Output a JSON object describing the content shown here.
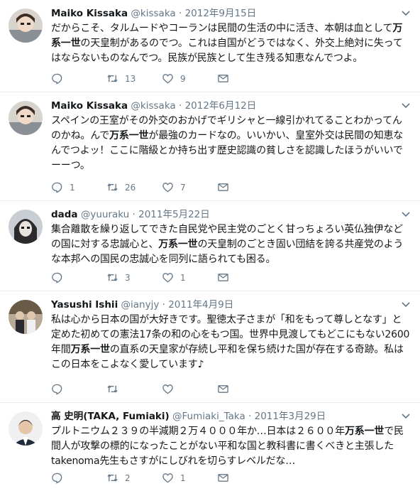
{
  "tweets": [
    {
      "name": "Maiko Kissaka",
      "handle": "@kissaka",
      "dot": "·",
      "time": "2012年9月15日",
      "segments": [
        {
          "t": "だからこそ、タルムードやコーランは民間の生活の中に活き、本朝は血として",
          "b": false
        },
        {
          "t": "万系一世",
          "b": true
        },
        {
          "t": "の天皇制があるのでつ。これは自国がどうではなく、外交上絶対に失ってはならないものなんでつ。民族が民族として生き残る知恵なんでつよ。",
          "b": false
        }
      ],
      "reply": "",
      "retweets": "13",
      "likes": "9"
    },
    {
      "name": "Maiko Kissaka",
      "handle": "@kissaka",
      "dot": "·",
      "time": "2012年6月12日",
      "segments": [
        {
          "t": "スペインの王室がその外交のおかげでギリシャと一線引かれてることわかってんのかね。んで",
          "b": false
        },
        {
          "t": "万系一世",
          "b": true
        },
        {
          "t": "が最強のカードなの。いいかい、皇室外交は民間の知恵なんでつよッ！ここに階級とか持ち出す歴史認識の貧しさを認識したほうがいいでーーつ。",
          "b": false
        }
      ],
      "reply": "1",
      "retweets": "26",
      "likes": "7"
    },
    {
      "name": "dada",
      "handle": "@yuuraku",
      "dot": "·",
      "time": "2011年5月22日",
      "segments": [
        {
          "t": "集合離散を繰り返してできた自民党や民主党のごとく甘っちょろい英仏独伊などの国に対する忠誠心と、",
          "b": false
        },
        {
          "t": "万系一世",
          "b": true
        },
        {
          "t": "の天皇制のごとき固い団結を誇る共産党のような本邦への国民の忠誠心を同列に語られても困る。",
          "b": false
        }
      ],
      "reply": "",
      "retweets": "3",
      "likes": "1"
    },
    {
      "name": "Yasushi Ishii",
      "handle": "@ianyjy",
      "dot": "·",
      "time": "2011年4月9日",
      "segments": [
        {
          "t": "私は心から日本の国が大好きです。聖徳太子さまが「和をもって尊しとなす」と定めた初めての憲法17条の和の心をもつ国。世界中見渡してもどこにもない2600年間",
          "b": false
        },
        {
          "t": "万系一世",
          "b": true
        },
        {
          "t": "の直系の天皇家が存続し平和を保ち続けた国が存在する奇跡。私はこの日本をこよなく愛しています♪",
          "b": false
        }
      ],
      "reply": "",
      "retweets": "",
      "likes": ""
    },
    {
      "name": "高 史明(TAKA, Fumiaki)",
      "handle": "@Fumiaki_Taka",
      "dot": "·",
      "time": "2011年3月29日",
      "segments": [
        {
          "t": "プルトニウム２３９の半減期２万４０００年か…日本は２６００年",
          "b": false
        },
        {
          "t": "万系一世",
          "b": true
        },
        {
          "t": "で民間人が攻撃の標的になったことがない平和な国と教科書に書くべきと主張したtakenoma先生もさすがにしびれを切らすレベルだな…",
          "b": false
        }
      ],
      "reply": "",
      "retweets": "2",
      "likes": "1"
    }
  ],
  "colors": {
    "text": "#14171a",
    "secondary": "#657786",
    "divider": "#e6ecf0"
  }
}
